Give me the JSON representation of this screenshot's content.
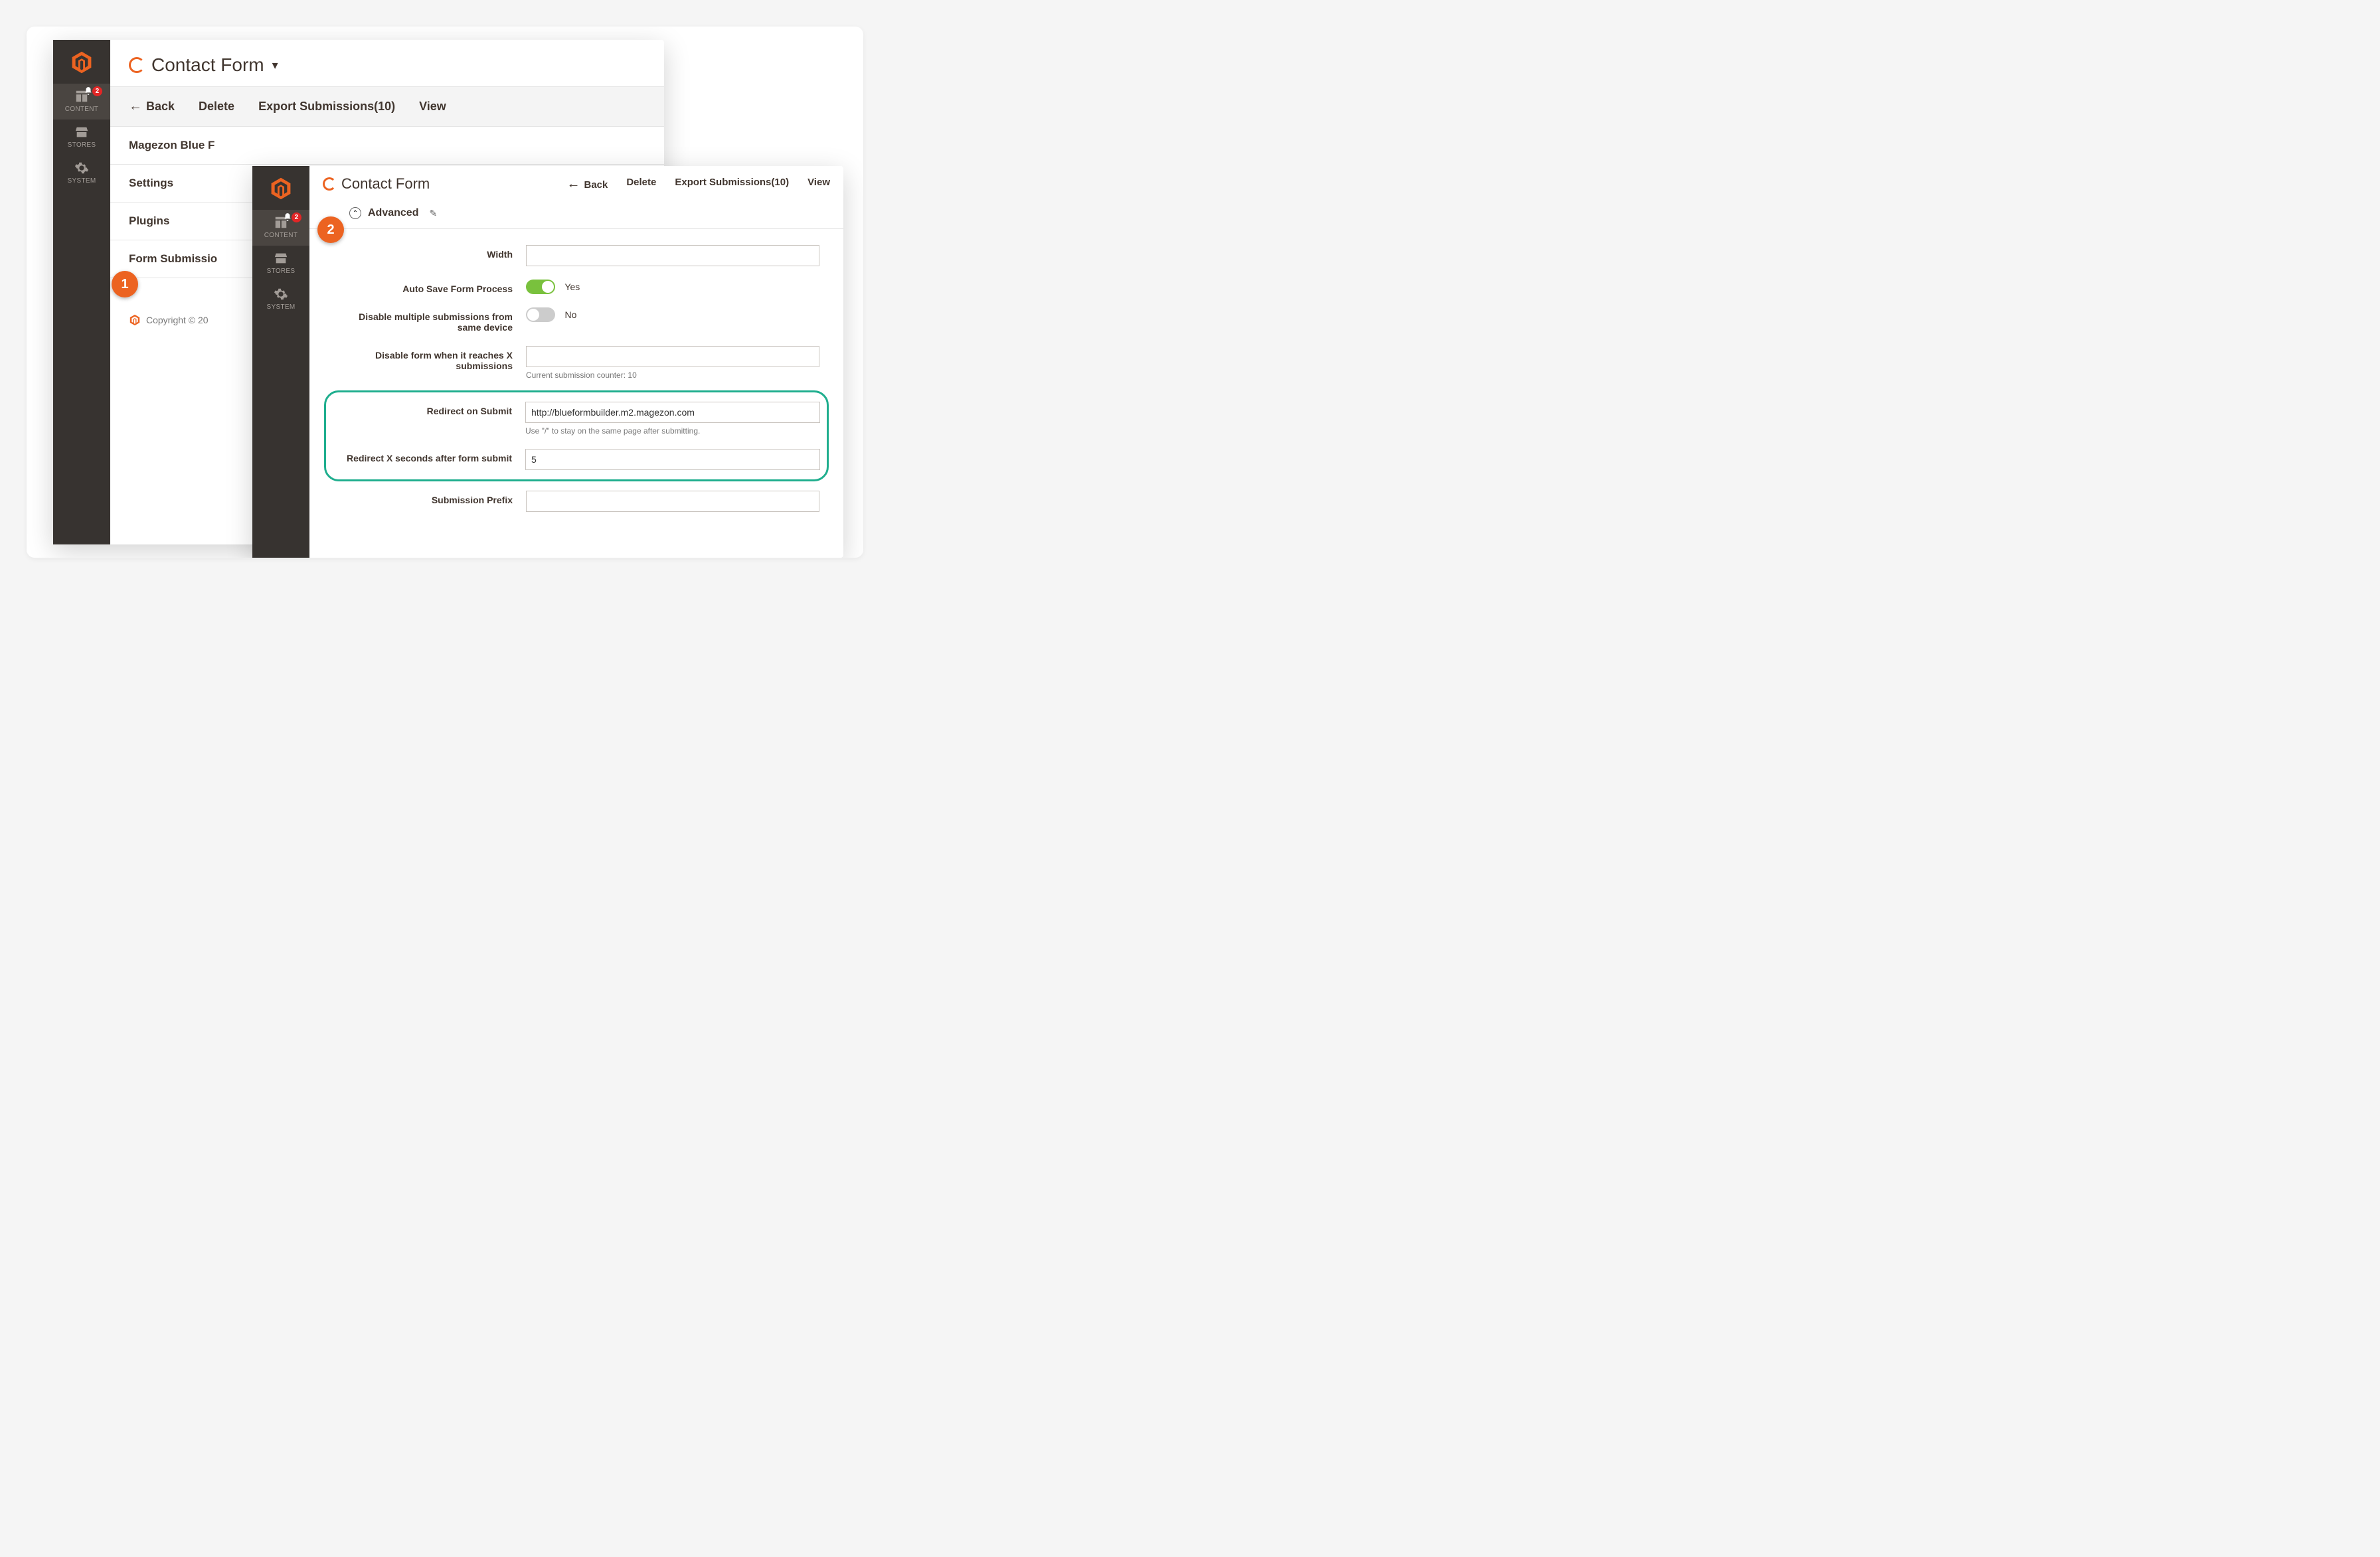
{
  "brand_color": "#ec6321",
  "sidebar": {
    "items": [
      {
        "label": "CONTENT",
        "icon": "content"
      },
      {
        "label": "STORES",
        "icon": "stores"
      },
      {
        "label": "SYSTEM",
        "icon": "system"
      }
    ],
    "badge_count": "2"
  },
  "w1": {
    "title": "Contact Form",
    "toolbar": [
      "Back",
      "Delete",
      "Export Submissions(10)",
      "View"
    ],
    "sections": [
      "Magezon Blue F",
      "Settings",
      "Plugins",
      "Form Submissio"
    ],
    "footer": "Copyright © 20"
  },
  "w2": {
    "title": "Contact Form",
    "toolbar": [
      "Back",
      "Delete",
      "Export Submissions(10)",
      "View"
    ],
    "section": "Advanced",
    "fields": {
      "width": {
        "label": "Width",
        "value": ""
      },
      "autosave": {
        "label": "Auto Save Form Process",
        "value": "Yes",
        "on": true
      },
      "multi": {
        "label": "Disable multiple submissions from same device",
        "value": "No",
        "on": false
      },
      "maxsub": {
        "label": "Disable form when it reaches X submissions",
        "value": "",
        "hint": "Current submission counter: 10"
      },
      "redirect": {
        "label": "Redirect on Submit",
        "value": "http://blueformbuilder.m2.magezon.com",
        "hint": "Use \"/\" to stay on the same page after submitting."
      },
      "delay": {
        "label": "Redirect X seconds after form submit",
        "value": "5"
      },
      "prefix": {
        "label": "Submission Prefix",
        "value": ""
      }
    }
  },
  "annot": {
    "n1": "1",
    "n2": "2"
  }
}
